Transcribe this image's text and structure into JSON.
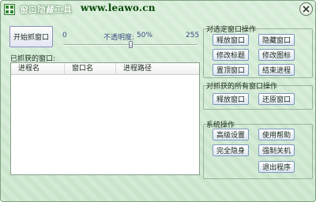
{
  "window": {
    "title": "窗口隐藏工具",
    "url": "www.leawo.cn"
  },
  "capture": {
    "button_label": "开始抓窗口"
  },
  "opacity": {
    "min_label": "0",
    "label": "不透明度:",
    "value_label": "50%",
    "max_label": "255",
    "level_percent": 50
  },
  "captured": {
    "label": "已抓获的窗口:",
    "columns": [
      "进程名",
      "窗口名",
      "进程路径"
    ]
  },
  "selected_ops": {
    "title": "对选定窗口操作",
    "buttons": [
      "释放窗口",
      "隐藏窗口",
      "修改标题",
      "修改图标",
      "置顶窗口",
      "结束进程"
    ]
  },
  "all_ops": {
    "title": "对抓获的所有窗口操作",
    "buttons": [
      "释放窗口",
      "还原窗口"
    ]
  },
  "system_ops": {
    "title": "系统操作",
    "buttons": [
      "高级设置",
      "使用帮助",
      "完全隐身",
      "强制关机",
      "退出程序"
    ]
  },
  "icons": {
    "app": "app-logo-icon",
    "close": "close-icon"
  },
  "colors": {
    "background": "#cfe8d0",
    "title_url": "#0a4a0a",
    "button_border": "#7c98bf"
  }
}
